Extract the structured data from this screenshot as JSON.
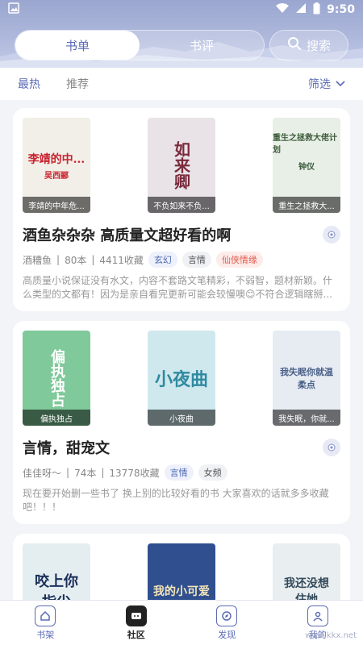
{
  "status": {
    "time": "9:50"
  },
  "header": {
    "tabs": [
      {
        "label": "书单",
        "active": true
      },
      {
        "label": "书评",
        "active": false
      }
    ],
    "search_label": "搜索"
  },
  "filters": {
    "hot": "最热",
    "recommend": "推荐",
    "filter": "筛选"
  },
  "cards": [
    {
      "covers": [
        {
          "caption": "李靖的中年危...",
          "title": "李靖的中...",
          "author": "吴西郦",
          "bg": "#f1efe8",
          "ink": "#c9232f"
        },
        {
          "caption": "不负如来不负...",
          "title": "如来卿",
          "bg": "#e9e3e8",
          "ink": "#7a2a3b"
        },
        {
          "caption": "重生之拯救大...",
          "title": "重生之拯救大佬计划",
          "author": "钟仪",
          "bg": "#e8efe7",
          "ink": "#3d5c3b"
        }
      ],
      "title": "酒鱼杂杂杂 高质量文超好看的啊",
      "author": "酒糟鱼",
      "books": "80本",
      "favs": "4411收藏",
      "tags": [
        "玄幻",
        "言情",
        "仙侠情缘"
      ],
      "desc": "高质量小说保证没有水文，内容不套路文笔精彩，不弱智，题材新颖。什么类型的文都有！因为是亲自看完更新可能会较慢噢😊不符合逻辑瞎掰..."
    },
    {
      "covers": [
        {
          "caption": "偏执独占",
          "title": "偏执独占",
          "bg": "#7fc99a",
          "ink": "#ffffff"
        },
        {
          "caption": "小夜曲",
          "title": "小夜曲",
          "bg": "#cfe8ee",
          "ink": "#2f8aa0"
        },
        {
          "caption": "我失眠，你就...",
          "title": "我失眠你就温柔点",
          "bg": "#e6ecf2",
          "ink": "#4a6088"
        }
      ],
      "title": "言情，甜宠文",
      "author": "佳佳呀～",
      "books": "74本",
      "favs": "13778收藏",
      "tags": [
        "言情",
        "女频"
      ],
      "desc": "现在要开始删一些书了 换上别的比较好看的书 大家喜欢的话就多多收藏吧！！！"
    },
    {
      "covers": [
        {
          "caption": "",
          "title": "咬上你指尖",
          "bg": "#e4eef0",
          "ink": "#1b2f5a"
        },
        {
          "caption": "",
          "title": "我的小可爱",
          "bg": "#2f4f8f",
          "ink": "#f5e6b8"
        },
        {
          "caption": "",
          "title": "我还没想住她",
          "bg": "#e9eef1",
          "ink": "#334a5a"
        }
      ]
    }
  ],
  "nav": [
    {
      "label": "书架",
      "icon": "bookshelf-icon",
      "active": false
    },
    {
      "label": "社区",
      "icon": "community-icon",
      "active": true
    },
    {
      "label": "发现",
      "icon": "discover-icon",
      "active": false
    },
    {
      "label": "我的",
      "icon": "profile-icon",
      "active": false
    }
  ],
  "watermark": "www.kkx.net"
}
